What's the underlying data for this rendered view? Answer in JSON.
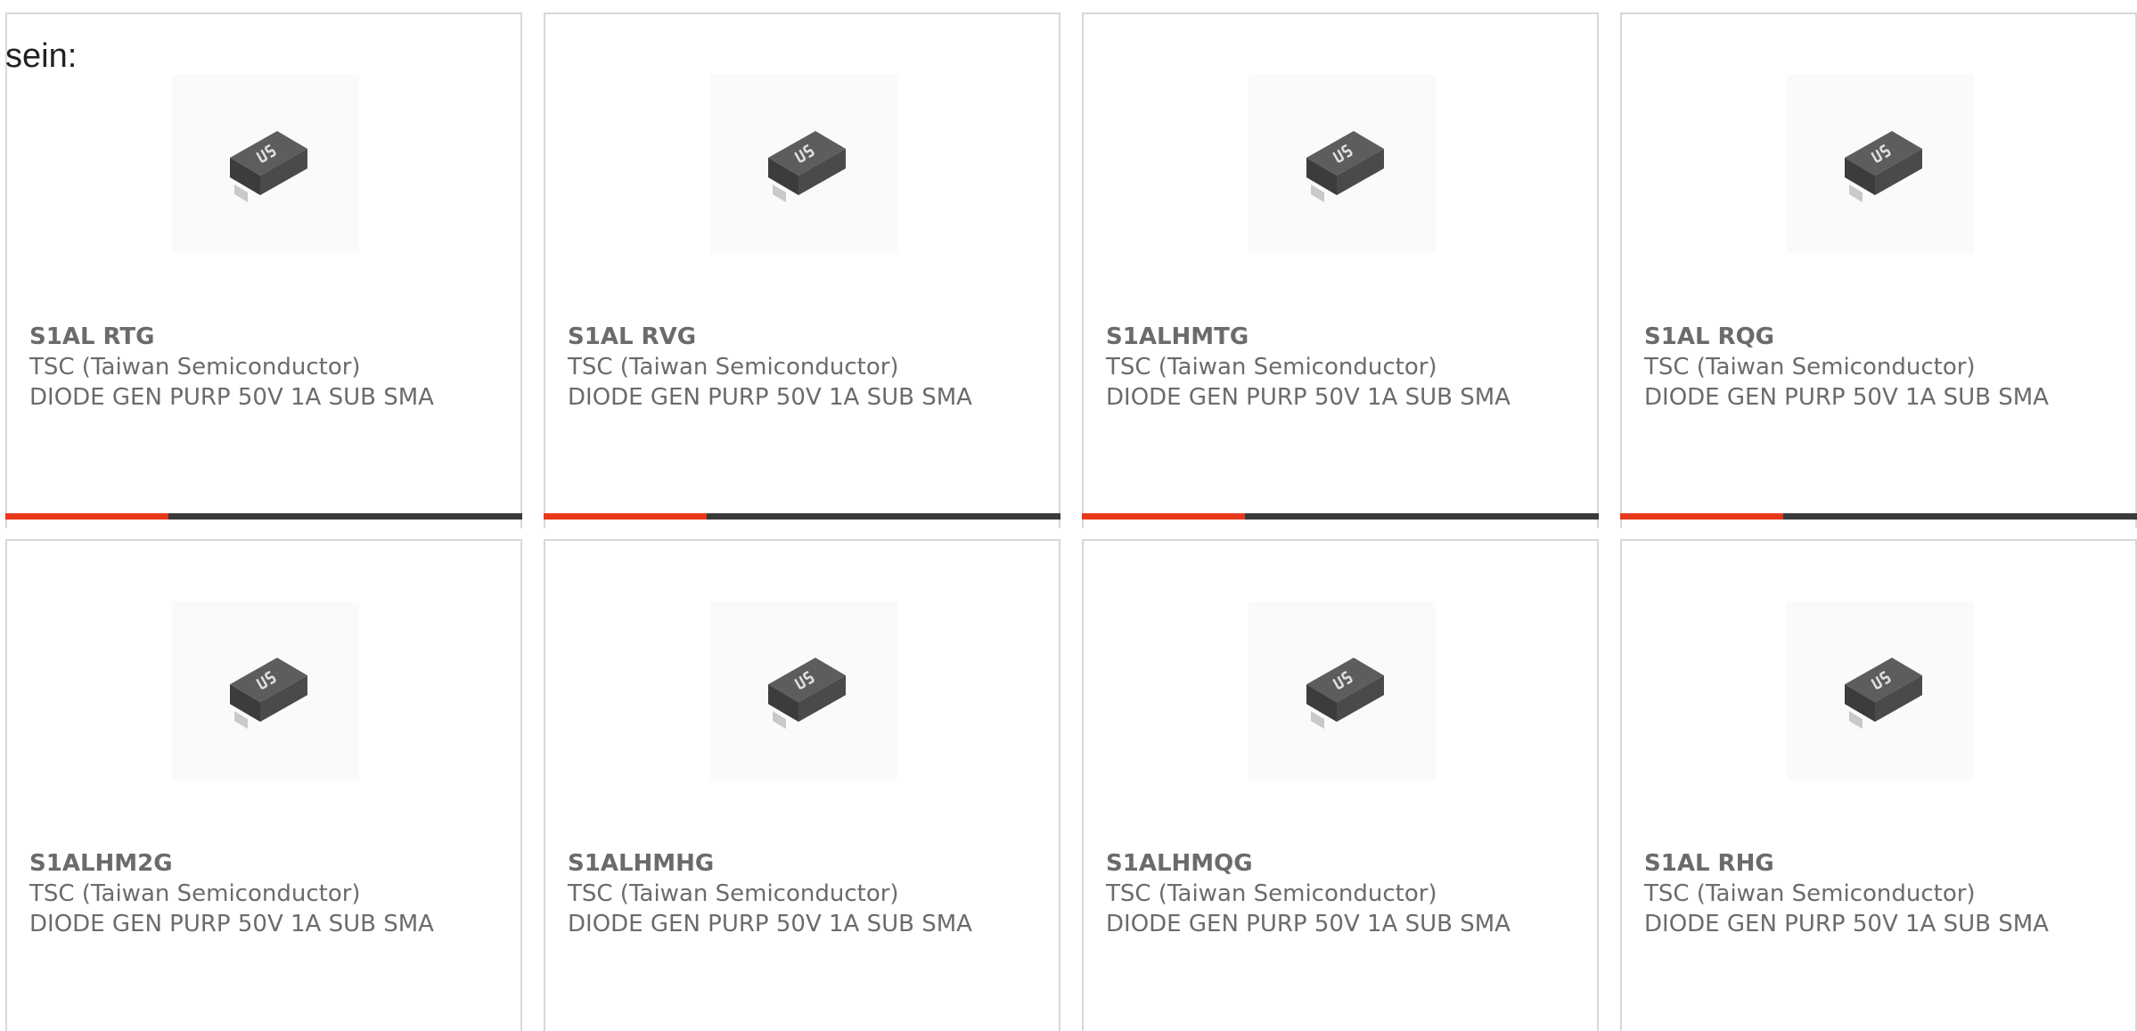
{
  "intro": {
    "text": "sein:"
  },
  "colors": {
    "accent": "#e8381b",
    "bar": "#3a3a3a",
    "text": "#6b6b6b",
    "border": "#d8d8d8"
  },
  "products": [
    {
      "part": "S1AL RTG",
      "manufacturer": "TSC (Taiwan Semiconductor)",
      "description": "DIODE GEN PURP 50V 1A SUB SMA",
      "image_icon": "sma-diode-package-icon"
    },
    {
      "part": "S1AL RVG",
      "manufacturer": "TSC (Taiwan Semiconductor)",
      "description": "DIODE GEN PURP 50V 1A SUB SMA",
      "image_icon": "sma-diode-package-icon"
    },
    {
      "part": "S1ALHMTG",
      "manufacturer": "TSC (Taiwan Semiconductor)",
      "description": "DIODE GEN PURP 50V 1A SUB SMA",
      "image_icon": "sma-diode-package-icon"
    },
    {
      "part": "S1AL RQG",
      "manufacturer": "TSC (Taiwan Semiconductor)",
      "description": "DIODE GEN PURP 50V 1A SUB SMA",
      "image_icon": "sma-diode-package-icon"
    },
    {
      "part": "S1ALHM2G",
      "manufacturer": "TSC (Taiwan Semiconductor)",
      "description": "DIODE GEN PURP 50V 1A SUB SMA",
      "image_icon": "sma-diode-package-icon"
    },
    {
      "part": "S1ALHMHG",
      "manufacturer": "TSC (Taiwan Semiconductor)",
      "description": "DIODE GEN PURP 50V 1A SUB SMA",
      "image_icon": "sma-diode-package-icon"
    },
    {
      "part": "S1ALHMQG",
      "manufacturer": "TSC (Taiwan Semiconductor)",
      "description": "DIODE GEN PURP 50V 1A SUB SMA",
      "image_icon": "sma-diode-package-icon"
    },
    {
      "part": "S1AL RHG",
      "manufacturer": "TSC (Taiwan Semiconductor)",
      "description": "DIODE GEN PURP 50V 1A SUB SMA",
      "image_icon": "sma-diode-package-icon"
    }
  ]
}
